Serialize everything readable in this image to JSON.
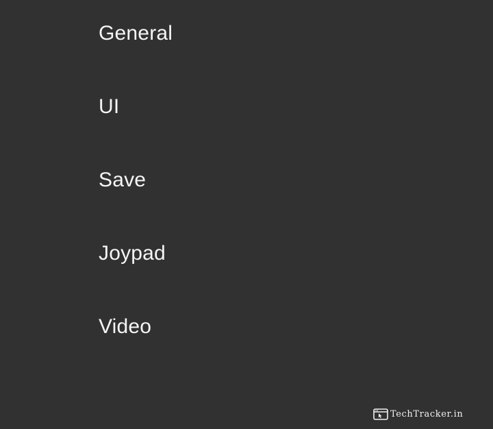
{
  "menu": {
    "items": [
      {
        "label": "General"
      },
      {
        "label": "UI"
      },
      {
        "label": "Save"
      },
      {
        "label": "Joypad"
      },
      {
        "label": "Video"
      }
    ]
  },
  "watermark": {
    "text": "TechTracker.in",
    "icon": "browser-cursor-icon"
  },
  "colors": {
    "background": "#313131",
    "text": "#f5f5f5"
  }
}
